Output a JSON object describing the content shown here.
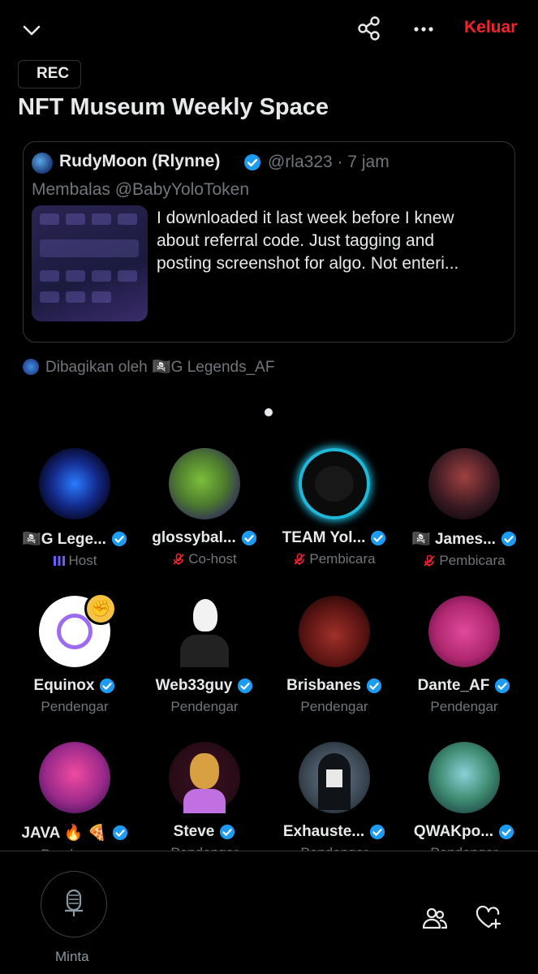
{
  "header": {
    "leave_label": "Keluar",
    "rec_label": "REC",
    "title": "NFT Museum Weekly Space"
  },
  "pinned_post": {
    "author_name": "RudyMoon (Rlynne)",
    "handle_time": "@rla323 · 7 jam",
    "reply_to": "Membalas @BabyYoloToken",
    "text": "I downloaded it last week before I knew\nabout referral code. Just tagging and\nposting screenshot for algo. Not enteri..."
  },
  "shared_by": "Dibagikan oleh 🏴‍☠️G Legends_AF",
  "participants": [
    {
      "name": "🏴‍☠️G Lege...",
      "role": "Host"
    },
    {
      "name": "glossybal...",
      "role": "Co-host"
    },
    {
      "name": "TEAM Yol...",
      "role": "Pembicara"
    },
    {
      "name": "🏴‍☠️ James...",
      "role": "Pembicara"
    },
    {
      "name": "Equinox",
      "role": "Pendengar"
    },
    {
      "name": "Web33guy",
      "role": "Pendengar"
    },
    {
      "name": "Brisbanes",
      "role": "Pendengar"
    },
    {
      "name": "Dante_AF",
      "role": "Pendengar"
    },
    {
      "name": "JAVA 🔥 🍕",
      "role": "Pendengar"
    },
    {
      "name": "Steve",
      "role": "Pendengar"
    },
    {
      "name": "Exhauste...",
      "role": "Pendengar"
    },
    {
      "name": "QWAKpo...",
      "role": "Pendengar"
    }
  ],
  "bottom_bar": {
    "mic_label": "Minta"
  },
  "colors": {
    "accent_red": "#f4212e",
    "verified_blue": "#1d9bf0",
    "muted_red": "#f4212e",
    "host_purple": "#6a5cff"
  }
}
